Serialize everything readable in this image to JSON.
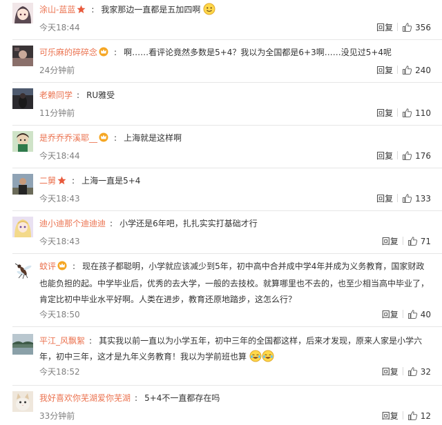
{
  "colors": {
    "username": "#eb7350",
    "time": "#808080",
    "divider": "#e6e6e6"
  },
  "labels": {
    "reply": "回复"
  },
  "comments": [
    {
      "name": "涂山-蓝蓝",
      "badge": "star",
      "text": "我家那边一直都是五加四啊",
      "emoji_after": "smile",
      "time": "今天18:44",
      "likes": "356",
      "avatar": "anime-girl"
    },
    {
      "name": "可乐麻的碎碎念",
      "badge": "crown",
      "text": "啊……看评论竟然多数是5+4？我以为全国都是6+3啊……没见过5+4呢",
      "time": "24分钟前",
      "likes": "240",
      "avatar": "dark-photo"
    },
    {
      "name": "老赖同学",
      "badge": "",
      "text": "RU雅受",
      "time": "11分钟前",
      "likes": "110",
      "avatar": "dark-figure"
    },
    {
      "name": "是乔乔乔溪耶__",
      "badge": "crown",
      "text": "上海就是这样啊",
      "time": "今天18:44",
      "likes": "176",
      "avatar": "green-character"
    },
    {
      "name": "二舅",
      "badge": "star",
      "text": "上海一直是5+4",
      "time": "今天18:43",
      "likes": "133",
      "avatar": "person-outdoor"
    },
    {
      "name": "迪小迪那个迪迪迪",
      "badge": "",
      "text": "小学还是6年吧，扎扎实实打基础才行",
      "time": "今天18:43",
      "likes": "71",
      "avatar": "blonde-anime"
    },
    {
      "name": "蚊评",
      "badge": "crown",
      "text": "现在孩子都聪明，小学就应该减少到5年，初中高中合并成中学4年并成为义务教育，国家财政也能负担的起。中学毕业后，优秀的去大学，一般的去技校。就算哪里也不去的，也至少相当高中毕业了，肯定比初中毕业水平好啊。人类在进步，教育还原地踏步，这怎么行？",
      "time": "今天18:50",
      "likes": "40",
      "avatar": "mosquito"
    },
    {
      "name": "平江_风飘絮",
      "badge": "",
      "text": "其实我以前一直以为小学五年，初中三年的全国都这样，后来才发现，原来人家是小学六年，初中三年，这才是九年义务教育！我以为学前班也算",
      "emoji_after": "laugh-cry",
      "time": "今天18:52",
      "likes": "32",
      "avatar": "landscape"
    },
    {
      "name": "我好喜欢你芜湖爱你芜湖",
      "badge": "",
      "text": "5+4不一直都存在吗",
      "time": "33分钟前",
      "likes": "12",
      "avatar": "cat"
    }
  ]
}
